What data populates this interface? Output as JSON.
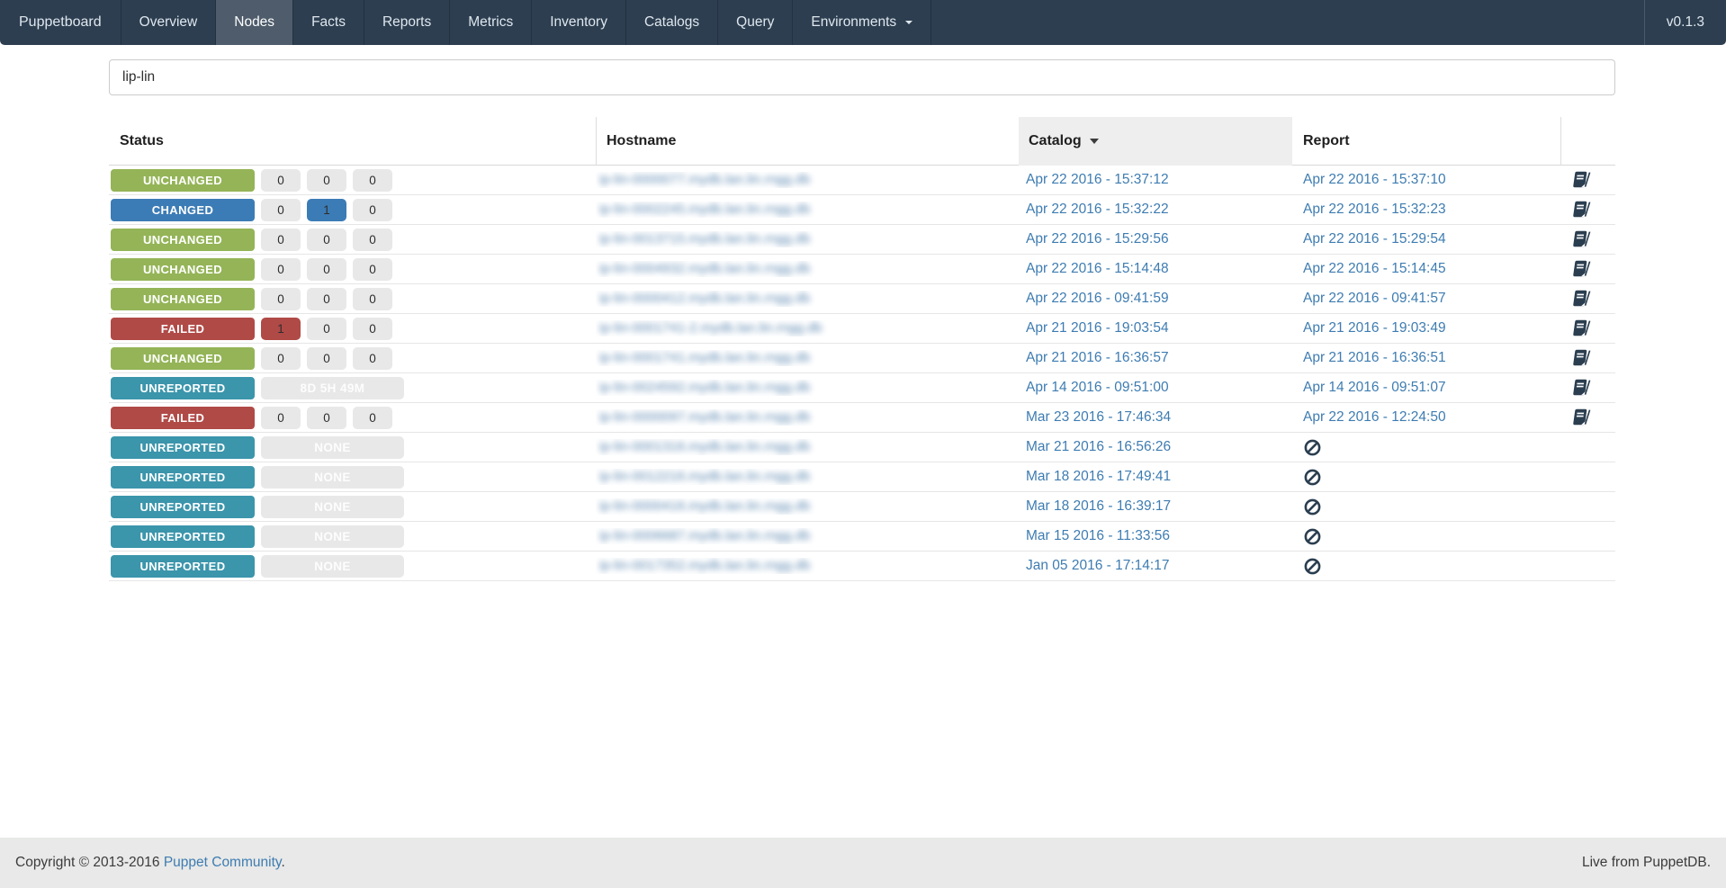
{
  "navbar": {
    "brand": "Puppetboard",
    "items": [
      "Overview",
      "Nodes",
      "Facts",
      "Reports",
      "Metrics",
      "Inventory",
      "Catalogs",
      "Query"
    ],
    "active": "Nodes",
    "environments_label": "Environments",
    "version": "v0.1.3"
  },
  "search": {
    "value": "lip-lin"
  },
  "table": {
    "columns": [
      "Status",
      "Hostname",
      "Catalog",
      "Report"
    ],
    "sorted_column": "Catalog",
    "sort_direction": "descending",
    "rows": [
      {
        "status": "UNCHANGED",
        "variant": "unchanged",
        "counts": [
          {
            "value": "0",
            "variant": "default"
          },
          {
            "value": "0",
            "variant": "default"
          },
          {
            "value": "0",
            "variant": "default"
          }
        ],
        "hostname_blurred": "ip-lin-0000077.mydb.lan.lin.rngg.db",
        "catalog": "Apr 22 2016 - 15:37:12",
        "report": "Apr 22 2016 - 15:37:10",
        "doc_icon": "book-icon"
      },
      {
        "status": "CHANGED",
        "variant": "changed",
        "counts": [
          {
            "value": "0",
            "variant": "default"
          },
          {
            "value": "1",
            "variant": "changed"
          },
          {
            "value": "0",
            "variant": "default"
          }
        ],
        "hostname_blurred": "ip-lin-0002245.mydb.lan.lin.rngg.db",
        "catalog": "Apr 22 2016 - 15:32:22",
        "report": "Apr 22 2016 - 15:32:23",
        "doc_icon": "book-icon"
      },
      {
        "status": "UNCHANGED",
        "variant": "unchanged",
        "counts": [
          {
            "value": "0",
            "variant": "default"
          },
          {
            "value": "0",
            "variant": "default"
          },
          {
            "value": "0",
            "variant": "default"
          }
        ],
        "hostname_blurred": "ip-lin-0013715.mydb.lan.lin.rngg.db",
        "catalog": "Apr 22 2016 - 15:29:56",
        "report": "Apr 22 2016 - 15:29:54",
        "doc_icon": "book-icon"
      },
      {
        "status": "UNCHANGED",
        "variant": "unchanged",
        "counts": [
          {
            "value": "0",
            "variant": "default"
          },
          {
            "value": "0",
            "variant": "default"
          },
          {
            "value": "0",
            "variant": "default"
          }
        ],
        "hostname_blurred": "ip-lin-0004932.mydb.lan.lin.rngg.db",
        "catalog": "Apr 22 2016 - 15:14:48",
        "report": "Apr 22 2016 - 15:14:45",
        "doc_icon": "book-icon"
      },
      {
        "status": "UNCHANGED",
        "variant": "unchanged",
        "counts": [
          {
            "value": "0",
            "variant": "default"
          },
          {
            "value": "0",
            "variant": "default"
          },
          {
            "value": "0",
            "variant": "default"
          }
        ],
        "hostname_blurred": "ip-lin-0000412.mydb.lan.lin.rngg.db",
        "catalog": "Apr 22 2016 - 09:41:59",
        "report": "Apr 22 2016 - 09:41:57",
        "doc_icon": "book-icon"
      },
      {
        "status": "FAILED",
        "variant": "failed",
        "counts": [
          {
            "value": "1",
            "variant": "failed"
          },
          {
            "value": "0",
            "variant": "default"
          },
          {
            "value": "0",
            "variant": "default"
          }
        ],
        "hostname_blurred": "ip-lin-0001741-2.mydb.lan.lin.rngg.db",
        "catalog": "Apr 21 2016 - 19:03:54",
        "report": "Apr 21 2016 - 19:03:49",
        "doc_icon": "book-icon"
      },
      {
        "status": "UNCHANGED",
        "variant": "unchanged",
        "counts": [
          {
            "value": "0",
            "variant": "default"
          },
          {
            "value": "0",
            "variant": "default"
          },
          {
            "value": "0",
            "variant": "default"
          }
        ],
        "hostname_blurred": "ip-lin-0001741.mydb.lan.lin.rngg.db",
        "catalog": "Apr 21 2016 - 16:36:57",
        "report": "Apr 21 2016 - 16:36:51",
        "doc_icon": "book-icon"
      },
      {
        "status": "UNREPORTED",
        "variant": "unreported",
        "duration_badge": "8D 5H 49M",
        "hostname_blurred": "ip-lin-0024592.mydb.lan.lin.rngg.db",
        "catalog": "Apr 14 2016 - 09:51:00",
        "report": "Apr 14 2016 - 09:51:07",
        "doc_icon": "book-icon"
      },
      {
        "status": "FAILED",
        "variant": "failed",
        "counts": [
          {
            "value": "0",
            "variant": "default"
          },
          {
            "value": "0",
            "variant": "default"
          },
          {
            "value": "0",
            "variant": "default"
          }
        ],
        "hostname_blurred": "ip-lin-0000097.mydb.lan.lin.rngg.db",
        "catalog": "Mar 23 2016 - 17:46:34",
        "report": "Apr 22 2016 - 12:24:50",
        "doc_icon": "book-icon"
      },
      {
        "status": "UNREPORTED",
        "variant": "unreported",
        "duration_badge": "NONE",
        "hostname_blurred": "ip-lin-0001316.mydb.lan.lin.rngg.db",
        "catalog": "Mar 21 2016 - 16:56:26",
        "report": "",
        "no_report_icon": "ban-icon"
      },
      {
        "status": "UNREPORTED",
        "variant": "unreported",
        "duration_badge": "NONE",
        "hostname_blurred": "ip-lin-0012216.mydb.lan.lin.rngg.db",
        "catalog": "Mar 18 2016 - 17:49:41",
        "report": "",
        "no_report_icon": "ban-icon"
      },
      {
        "status": "UNREPORTED",
        "variant": "unreported",
        "duration_badge": "NONE",
        "hostname_blurred": "ip-lin-0000416.mydb.lan.lin.rngg.db",
        "catalog": "Mar 18 2016 - 16:39:17",
        "report": "",
        "no_report_icon": "ban-icon"
      },
      {
        "status": "UNREPORTED",
        "variant": "unreported",
        "duration_badge": "NONE",
        "hostname_blurred": "ip-lin-0006687.mydb.lan.lin.rngg.db",
        "catalog": "Mar 15 2016 - 11:33:56",
        "report": "",
        "no_report_icon": "ban-icon"
      },
      {
        "status": "UNREPORTED",
        "variant": "unreported",
        "duration_badge": "NONE",
        "hostname_blurred": "ip-lin-0017352.mydb.lan.lin.rngg.db",
        "catalog": "Jan 05 2016 - 17:14:17",
        "report": "",
        "no_report_icon": "ban-icon"
      }
    ]
  },
  "footer": {
    "copyright_prefix": "Copyright © 2013-2016 ",
    "copyright_link": "Puppet Community",
    "copyright_suffix": ".",
    "right_text": "Live from PuppetDB."
  },
  "colors": {
    "navbar_bg": "#2d3e50",
    "navbar_active_bg": "#4e5c6b",
    "link": "#3e7cb1",
    "status_unchanged": "#94b457",
    "status_changed": "#3c7cb6",
    "status_failed": "#b04a47",
    "status_unreported": "#3b95ab",
    "count_badge_bg": "#e8e8e8",
    "sorted_header_bg": "#eeeeee",
    "footer_bg": "#e8e9e8",
    "icon_dark": "#2b3e50"
  }
}
